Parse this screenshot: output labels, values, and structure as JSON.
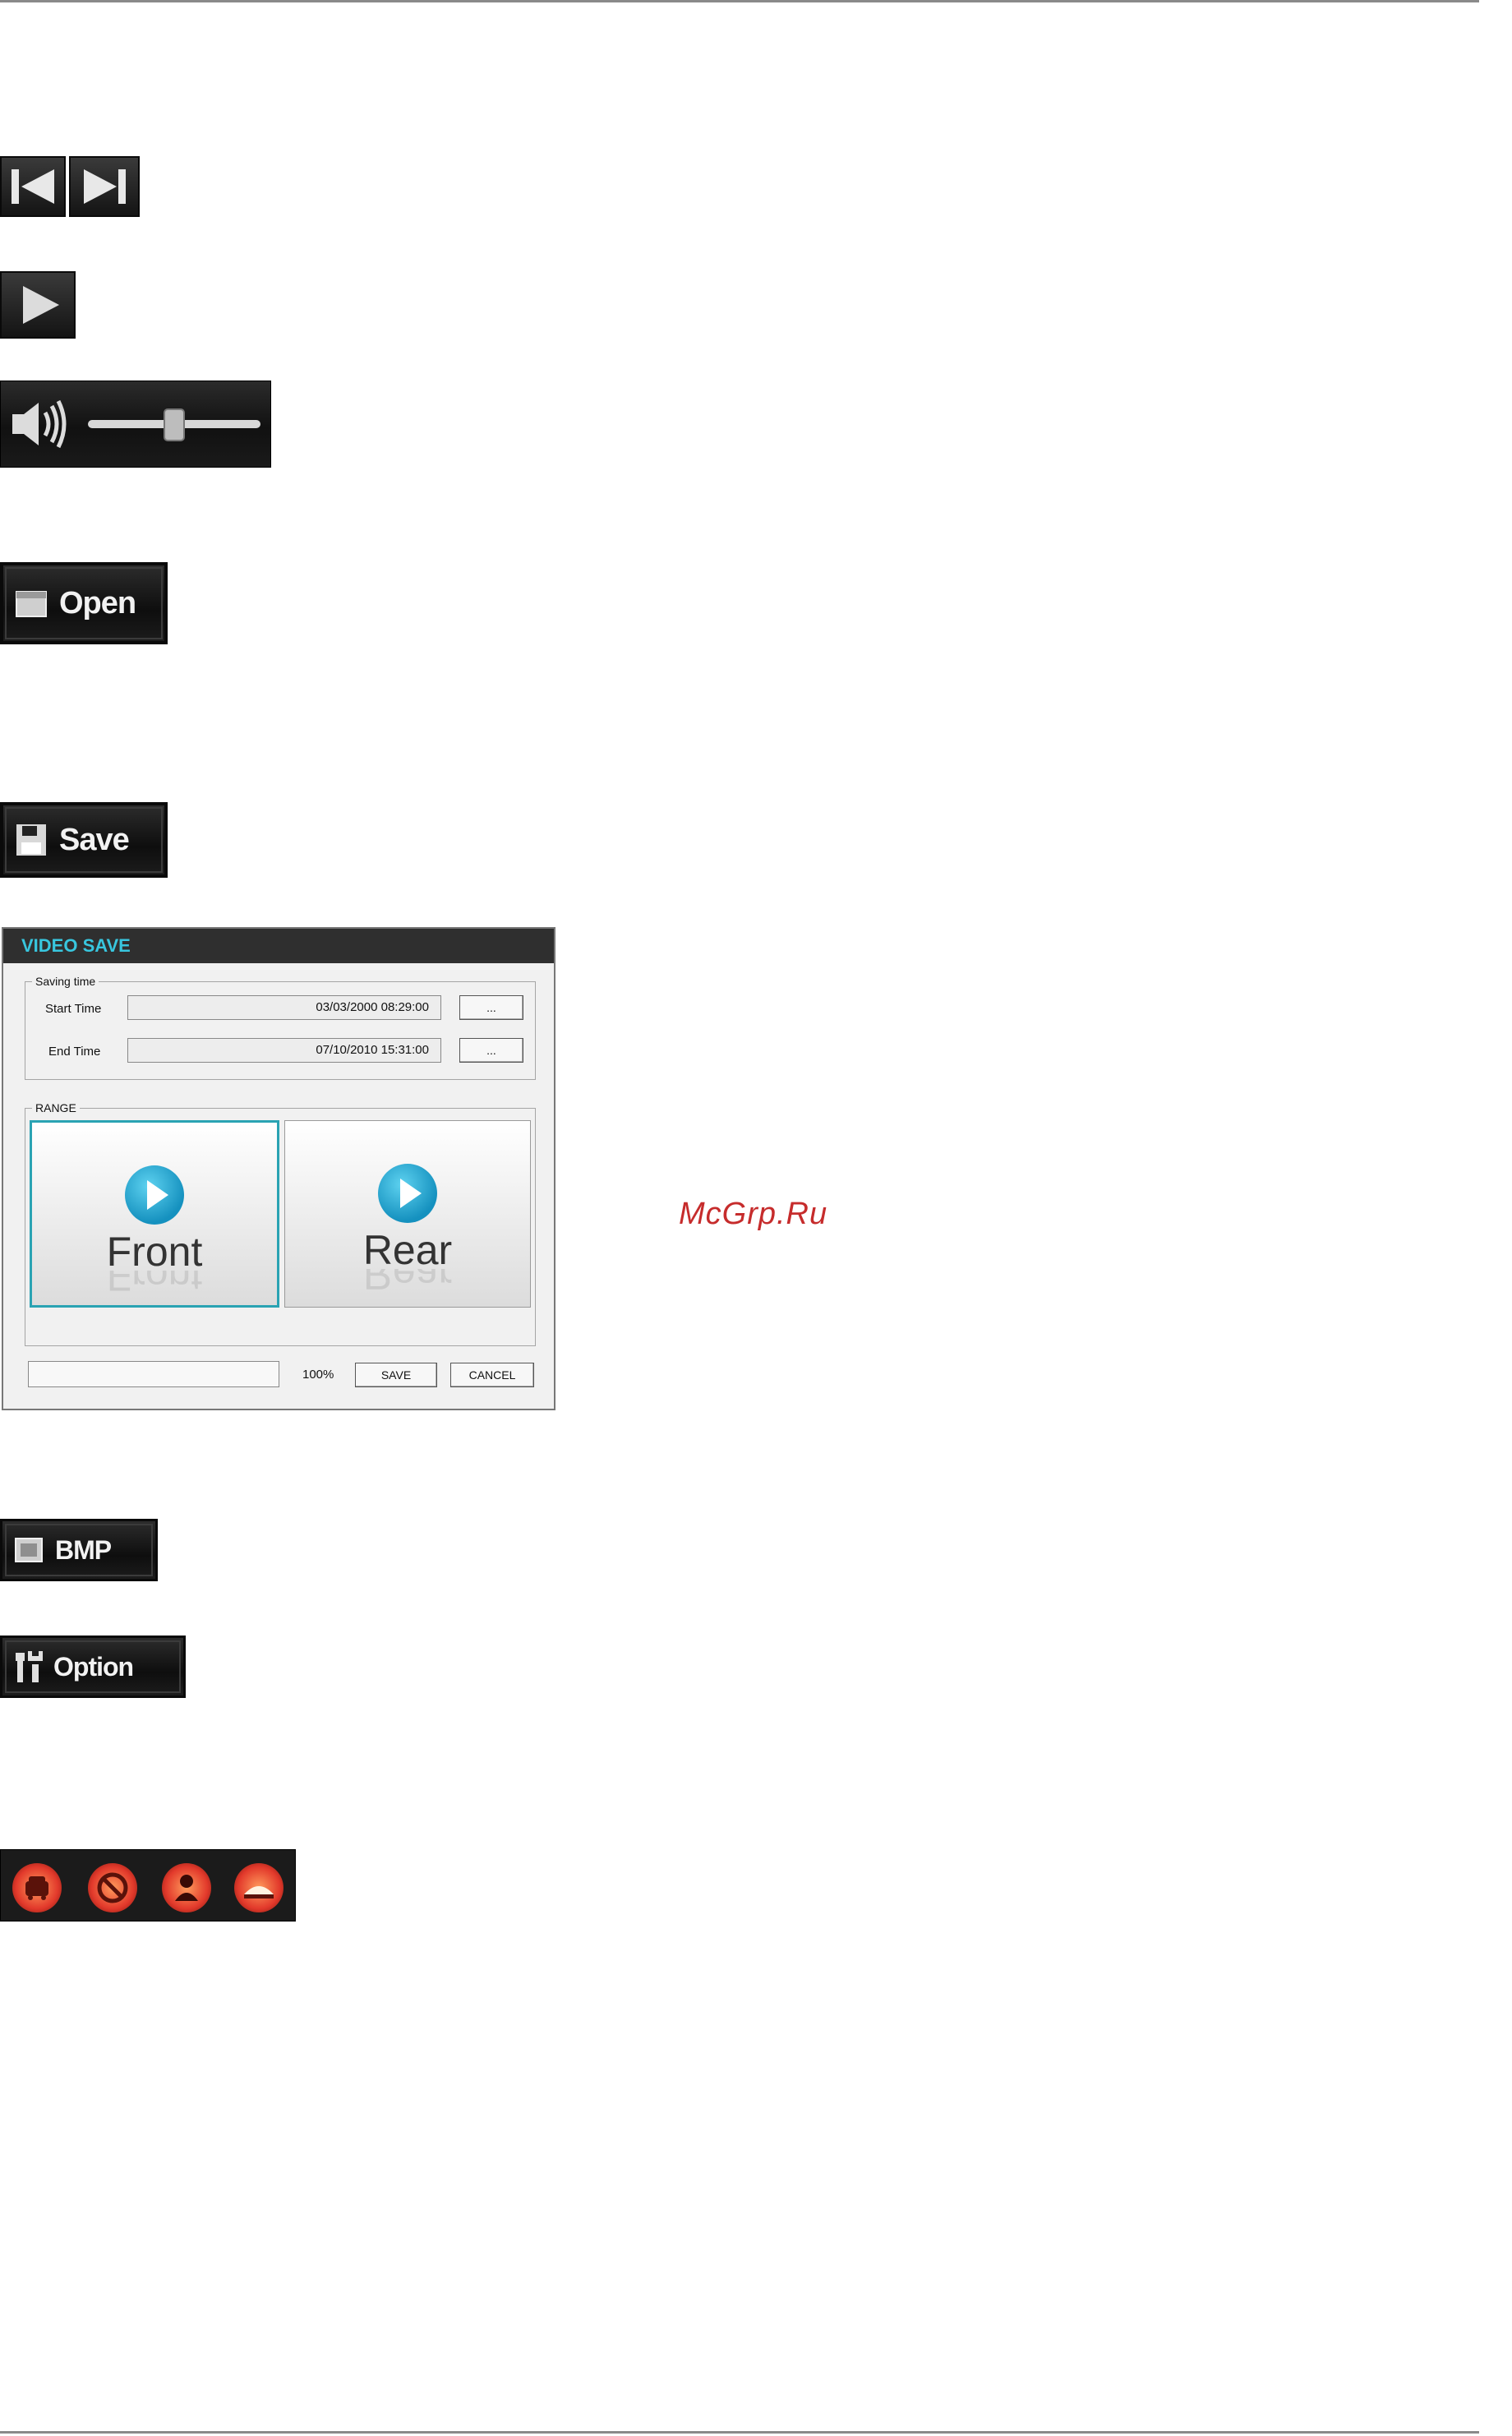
{
  "dialog": {
    "title": "VIDEO SAVE",
    "saving_time_legend": "Saving time",
    "start_label": "Start Time",
    "start_value": "03/03/2000 08:29:00",
    "end_label": "End Time",
    "end_value": "07/10/2010 15:31:00",
    "browse_label": "...",
    "range_legend": "RANGE",
    "front_label": "Front",
    "rear_label": "Rear",
    "progress_text": "100%",
    "progress_fraction": 0,
    "save_label": "SAVE",
    "cancel_label": "CANCEL"
  },
  "buttons": {
    "open_label": "Open",
    "save_label": "Save",
    "bmp_label": "BMP",
    "option_label": "Option"
  },
  "volume": {
    "level": 0.5
  },
  "icons": [
    "skip-back-icon",
    "skip-forward-icon",
    "play-icon",
    "speaker-icon",
    "folder-icon",
    "floppy-disk-icon",
    "image-icon",
    "wrench-icon",
    "car-icon",
    "no-entry-icon",
    "person-icon",
    "speed-bump-icon"
  ],
  "watermark": "McGrp.Ru",
  "colors": {
    "accent_cyan": "#38c6de",
    "watermark_red": "#c62c2c",
    "alert_red": "#e2392b"
  }
}
